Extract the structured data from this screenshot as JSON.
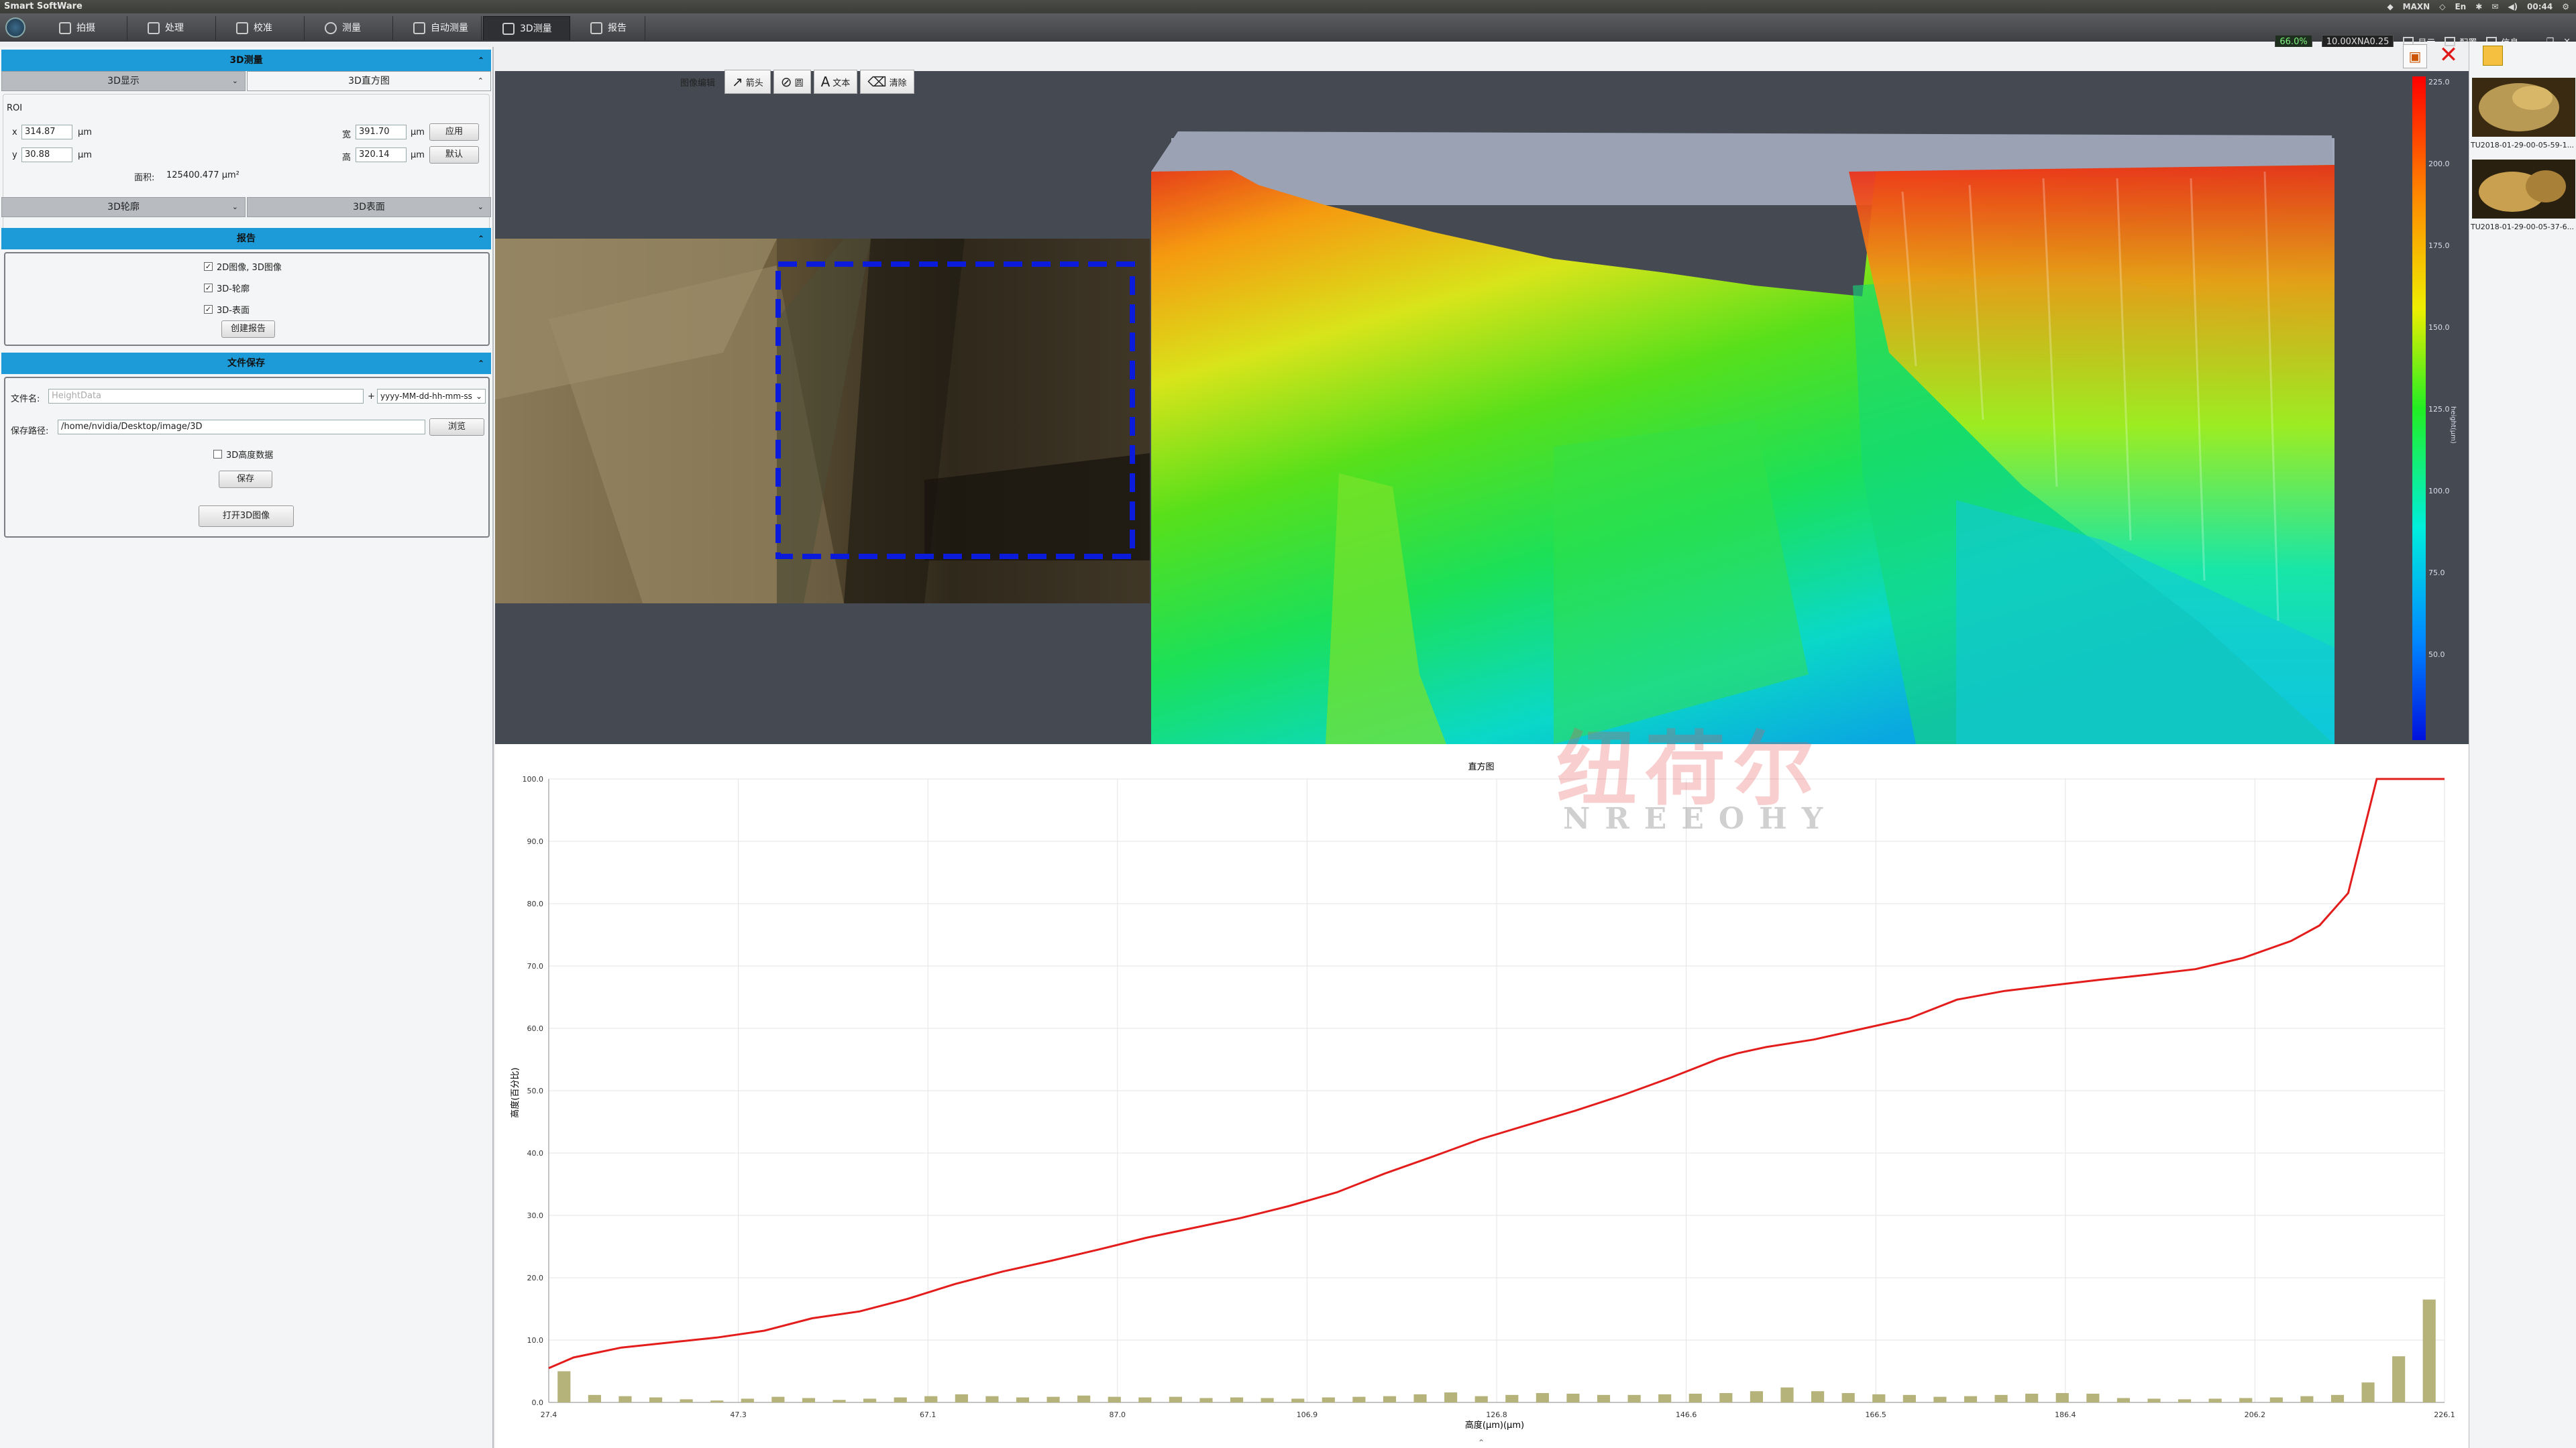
{
  "app": {
    "title": "Smart SoftWare"
  },
  "tabs": [
    {
      "label": "拍摄",
      "icon": "camera-icon"
    },
    {
      "label": "处理",
      "icon": "image-process-icon"
    },
    {
      "label": "校准",
      "icon": "ruler-icon"
    },
    {
      "label": "测量",
      "icon": "measure-icon"
    },
    {
      "label": "自动测量",
      "icon": "auto-measure-icon"
    },
    {
      "label": "3D测量",
      "icon": "3d-icon"
    },
    {
      "label": "报告",
      "icon": "report-icon"
    }
  ],
  "status": {
    "percent": "66.0%",
    "tag": "10.00XNA0.25",
    "display": "显示",
    "config": "配置",
    "info": "信息"
  },
  "system": {
    "mode": "MAXN",
    "time": "00:44"
  },
  "left": {
    "section_3d": "3D测量",
    "combo_display": "3D显示",
    "combo_histogram": "3D直方图",
    "roi_label": "ROI",
    "x_label": "x",
    "x_value": "314.87",
    "y_label": "y",
    "y_value": "30.88",
    "unit": "μm",
    "w_label": "宽",
    "w_value": "391.70",
    "h_label": "高",
    "h_value": "320.14",
    "apply": "应用",
    "default": "默认",
    "area_label": "面积:",
    "area_value": "125400.477  μm²",
    "combo_profile": "3D轮廓",
    "combo_surface": "3D表面",
    "section_report": "报告",
    "chk1": "2D图像, 3D图像",
    "chk2": "3D-轮廓",
    "chk3": "3D-表面",
    "create_report": "创建报告",
    "section_save": "文件保存",
    "filename_label": "文件名:",
    "filename_placeholder": "HeightData",
    "plus": "+",
    "date_format": "yyyy-MM-dd-hh-mm-ss",
    "path_label": "保存路径:",
    "path_value": "/home/nvidia/Desktop/image/3D",
    "browse": "浏览",
    "chk_height": "3D高度数据",
    "save": "保存",
    "open3d": "打开3D图像"
  },
  "toolbar": {
    "label": "图像编辑",
    "arrow": "箭头",
    "circle": "圆",
    "text": "文本",
    "clear": "清除"
  },
  "colorbar": {
    "ticks": [
      "225.0",
      "200.0",
      "175.0",
      "150.0",
      "125.0",
      "100.0",
      "75.0",
      "50.0"
    ],
    "label": "height(μm)"
  },
  "thumbnails": [
    {
      "label": "TU2018-01-29-00-05-59-1..."
    },
    {
      "label": "TU2018-01-29-00-05-37-6..."
    }
  ],
  "watermark": {
    "cn": "纽荷尔",
    "en": "NREEOHY"
  },
  "chart_data": {
    "type": "bar",
    "title": "直方图",
    "xlabel": "高度(μm)(μm)",
    "ylabel": "高度(百分比)",
    "ylim": [
      0,
      100
    ],
    "yticks": [
      "0.0",
      "10.0",
      "20.0",
      "30.0",
      "40.0",
      "50.0",
      "60.0",
      "70.0",
      "80.0",
      "90.0",
      "100.0"
    ],
    "xticks": [
      "27.4",
      "47.3",
      "67.1",
      "87.0",
      "106.9",
      "126.8",
      "146.6",
      "166.5",
      "186.4",
      "206.2",
      "226.1"
    ],
    "xlim": [
      27.4,
      226.1
    ],
    "bars": {
      "x": [
        28.4,
        31.6,
        34.8,
        38.0,
        41.2,
        44.4,
        47.6,
        50.8,
        54.0,
        57.2,
        60.4,
        63.6,
        66.8,
        70.0,
        73.2,
        76.4,
        79.6,
        82.8,
        86.0,
        89.2,
        92.4,
        95.6,
        98.8,
        102.0,
        105.2,
        108.4,
        111.6,
        114.8,
        118.0,
        121.2,
        124.4,
        127.6,
        130.8,
        134.0,
        137.2,
        140.4,
        143.6,
        146.8,
        150.0,
        153.2,
        156.4,
        159.6,
        162.8,
        166.0,
        169.2,
        172.4,
        175.6,
        178.8,
        182.0,
        185.2,
        188.4,
        191.6,
        194.8,
        198.0,
        201.2,
        204.4,
        207.6,
        210.8,
        214.0,
        217.2,
        220.4
      ],
      "values": [
        5.0,
        1.2,
        1.0,
        0.8,
        0.5,
        0.3,
        0.6,
        0.9,
        0.7,
        0.4,
        0.6,
        0.8,
        1.0,
        1.3,
        1.0,
        0.8,
        0.9,
        1.1,
        0.9,
        0.8,
        0.9,
        0.7,
        0.8,
        0.7,
        0.6,
        0.8,
        0.9,
        1.0,
        1.3,
        1.6,
        1.0,
        1.2,
        1.5,
        1.4,
        1.2,
        1.2,
        1.3,
        1.4,
        1.5,
        1.8,
        2.4,
        1.8,
        1.5,
        1.3,
        1.2,
        0.9,
        1.0,
        1.2,
        1.4,
        1.5,
        1.4,
        0.7,
        0.6,
        0.5,
        0.6,
        0.7,
        0.8,
        1.0,
        1.2,
        3.2,
        7.4,
        16.5
      ]
    },
    "cumulative": {
      "x": [
        27.4,
        30,
        35,
        40,
        45,
        50,
        55,
        60,
        65,
        70,
        75,
        80,
        85,
        90,
        95,
        100,
        105,
        110,
        115,
        120,
        125,
        130,
        135,
        140,
        145,
        150,
        152,
        155,
        160,
        165,
        170,
        175,
        180,
        185,
        190,
        195,
        200,
        205,
        210,
        213,
        216,
        219,
        222,
        226.1
      ],
      "values": [
        5.5,
        7.2,
        8.8,
        9.6,
        10.4,
        11.5,
        13.5,
        14.6,
        16.6,
        19.0,
        21.0,
        22.7,
        24.5,
        26.4,
        28.0,
        29.6,
        31.5,
        33.7,
        36.7,
        39.4,
        42.2,
        44.5,
        46.8,
        49.3,
        52.1,
        55.1,
        56.0,
        57.0,
        58.2,
        59.9,
        61.6,
        64.6,
        66.0,
        66.9,
        67.8,
        68.6,
        69.5,
        71.3,
        74.0,
        76.5,
        81.7,
        100.0,
        100.0,
        100.0
      ]
    },
    "bar_color": "#b5b27a",
    "line_color": "#e31c1c"
  }
}
